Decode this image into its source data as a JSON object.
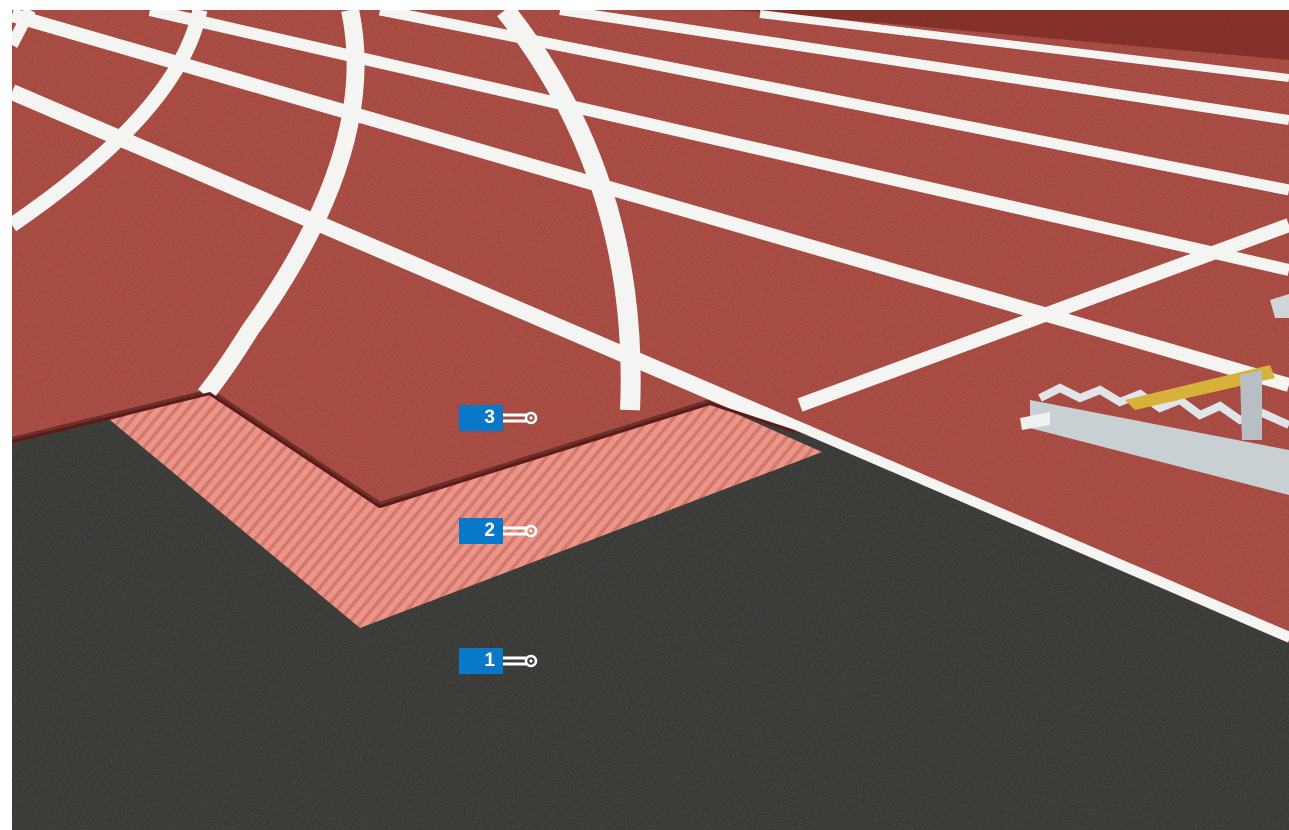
{
  "image": {
    "colors": {
      "track_red": "#a8392f",
      "track_red_dark": "#7e2520",
      "underlayer_black": "#2a2a27",
      "grooved_layer": "#e0857a",
      "line_white": "#f4f4f2",
      "badge_blue": "#0a78c8"
    }
  },
  "markers": [
    {
      "number": "3"
    },
    {
      "number": "2"
    },
    {
      "number": "1"
    }
  ]
}
